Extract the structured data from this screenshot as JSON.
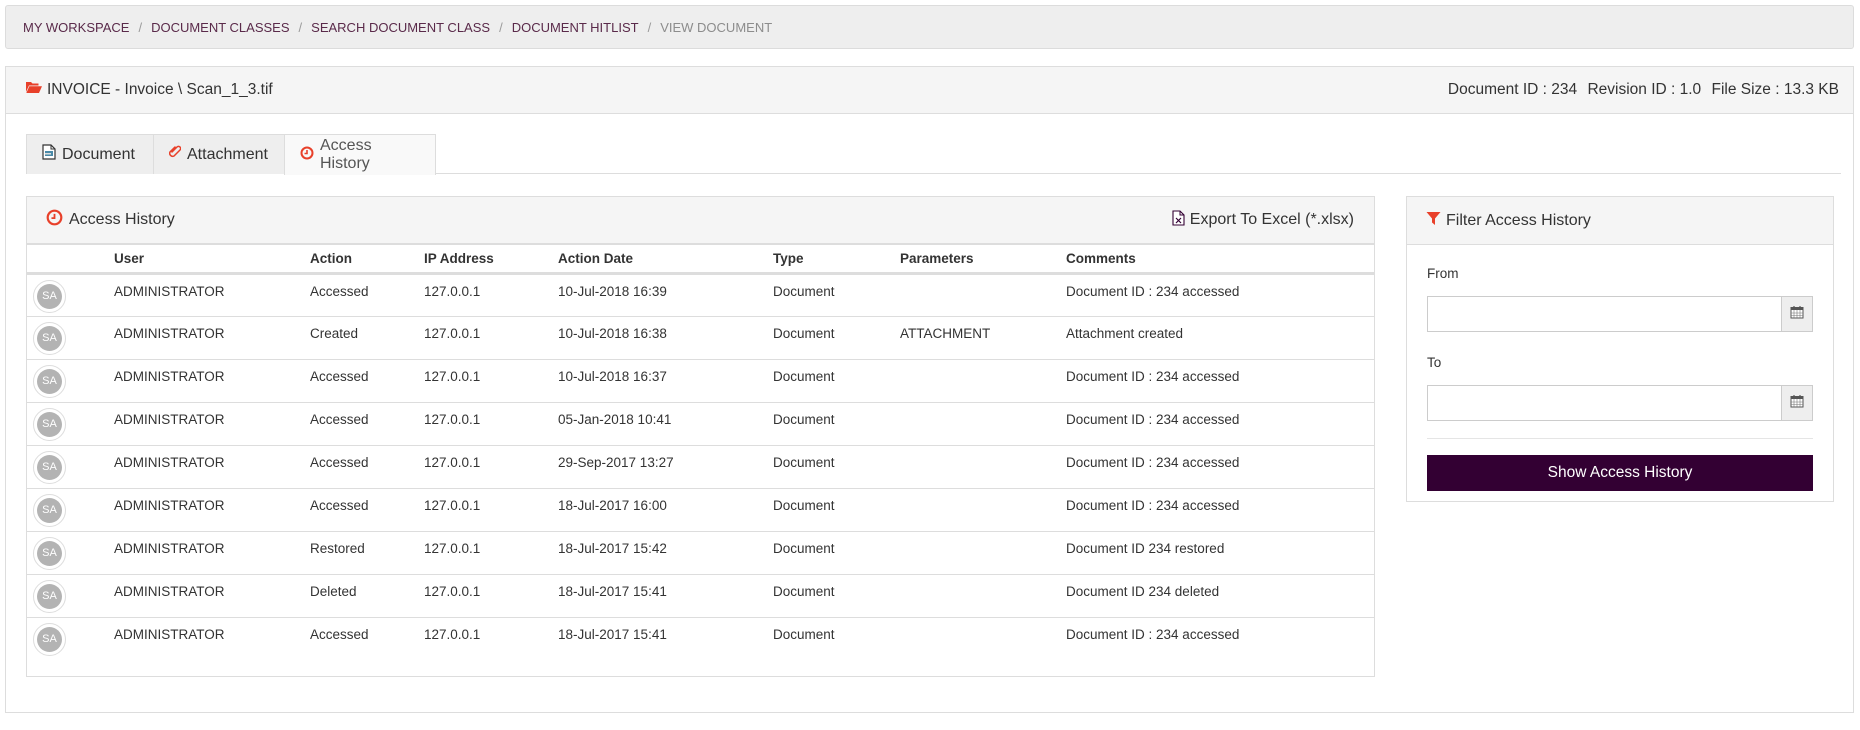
{
  "breadcrumb": [
    {
      "label": "MY WORKSPACE"
    },
    {
      "label": "DOCUMENT CLASSES"
    },
    {
      "label": "SEARCH DOCUMENT CLASS"
    },
    {
      "label": "DOCUMENT HITLIST"
    },
    {
      "label": "VIEW DOCUMENT"
    }
  ],
  "document": {
    "title": "INVOICE - Invoice \\ Scan_1_3.tif",
    "document_id": "Document ID : 234",
    "revision_id": "Revision ID : 1.0",
    "file_size": "File Size : 13.3 KB"
  },
  "tabs": [
    {
      "label": "Document",
      "icon": "document-icon",
      "active": false
    },
    {
      "label": "Attachment",
      "icon": "paperclip-icon",
      "active": false
    },
    {
      "label": "Access History",
      "icon": "clock-icon",
      "active": true
    }
  ],
  "access_history": {
    "title": "Access History",
    "export_label": "Export To Excel (*.xlsx)",
    "columns": [
      "",
      "User",
      "Action",
      "IP Address",
      "Action Date",
      "Type",
      "Parameters",
      "Comments"
    ],
    "rows": [
      {
        "avatar": "SA",
        "user": "ADMINISTRATOR",
        "action": "Accessed",
        "ip": "127.0.0.1",
        "date": "10-Jul-2018 16:39",
        "type": "Document",
        "parameters": "",
        "comments": "Document ID : 234 accessed"
      },
      {
        "avatar": "SA",
        "user": "ADMINISTRATOR",
        "action": "Created",
        "ip": "127.0.0.1",
        "date": "10-Jul-2018 16:38",
        "type": "Document",
        "parameters": "ATTACHMENT",
        "comments": "Attachment created"
      },
      {
        "avatar": "SA",
        "user": "ADMINISTRATOR",
        "action": "Accessed",
        "ip": "127.0.0.1",
        "date": "10-Jul-2018 16:37",
        "type": "Document",
        "parameters": "",
        "comments": "Document ID : 234 accessed"
      },
      {
        "avatar": "SA",
        "user": "ADMINISTRATOR",
        "action": "Accessed",
        "ip": "127.0.0.1",
        "date": "05-Jan-2018 10:41",
        "type": "Document",
        "parameters": "",
        "comments": "Document ID : 234 accessed"
      },
      {
        "avatar": "SA",
        "user": "ADMINISTRATOR",
        "action": "Accessed",
        "ip": "127.0.0.1",
        "date": "29-Sep-2017 13:27",
        "type": "Document",
        "parameters": "",
        "comments": "Document ID : 234 accessed"
      },
      {
        "avatar": "SA",
        "user": "ADMINISTRATOR",
        "action": "Accessed",
        "ip": "127.0.0.1",
        "date": "18-Jul-2017 16:00",
        "type": "Document",
        "parameters": "",
        "comments": "Document ID : 234 accessed"
      },
      {
        "avatar": "SA",
        "user": "ADMINISTRATOR",
        "action": "Restored",
        "ip": "127.0.0.1",
        "date": "18-Jul-2017 15:42",
        "type": "Document",
        "parameters": "",
        "comments": "Document ID 234 restored"
      },
      {
        "avatar": "SA",
        "user": "ADMINISTRATOR",
        "action": "Deleted",
        "ip": "127.0.0.1",
        "date": "18-Jul-2017 15:41",
        "type": "Document",
        "parameters": "",
        "comments": "Document ID 234 deleted"
      },
      {
        "avatar": "SA",
        "user": "ADMINISTRATOR",
        "action": "Accessed",
        "ip": "127.0.0.1",
        "date": "18-Jul-2017 15:41",
        "type": "Document",
        "parameters": "",
        "comments": "Document ID : 234 accessed"
      }
    ]
  },
  "filter": {
    "title": "Filter Access History",
    "from_label": "From",
    "from_value": "",
    "to_label": "To",
    "to_value": "",
    "button_label": "Show Access History"
  },
  "colors": {
    "accent_red": "#e8402a",
    "button_bg": "#330033",
    "breadcrumb_link": "#5a2a4a"
  }
}
